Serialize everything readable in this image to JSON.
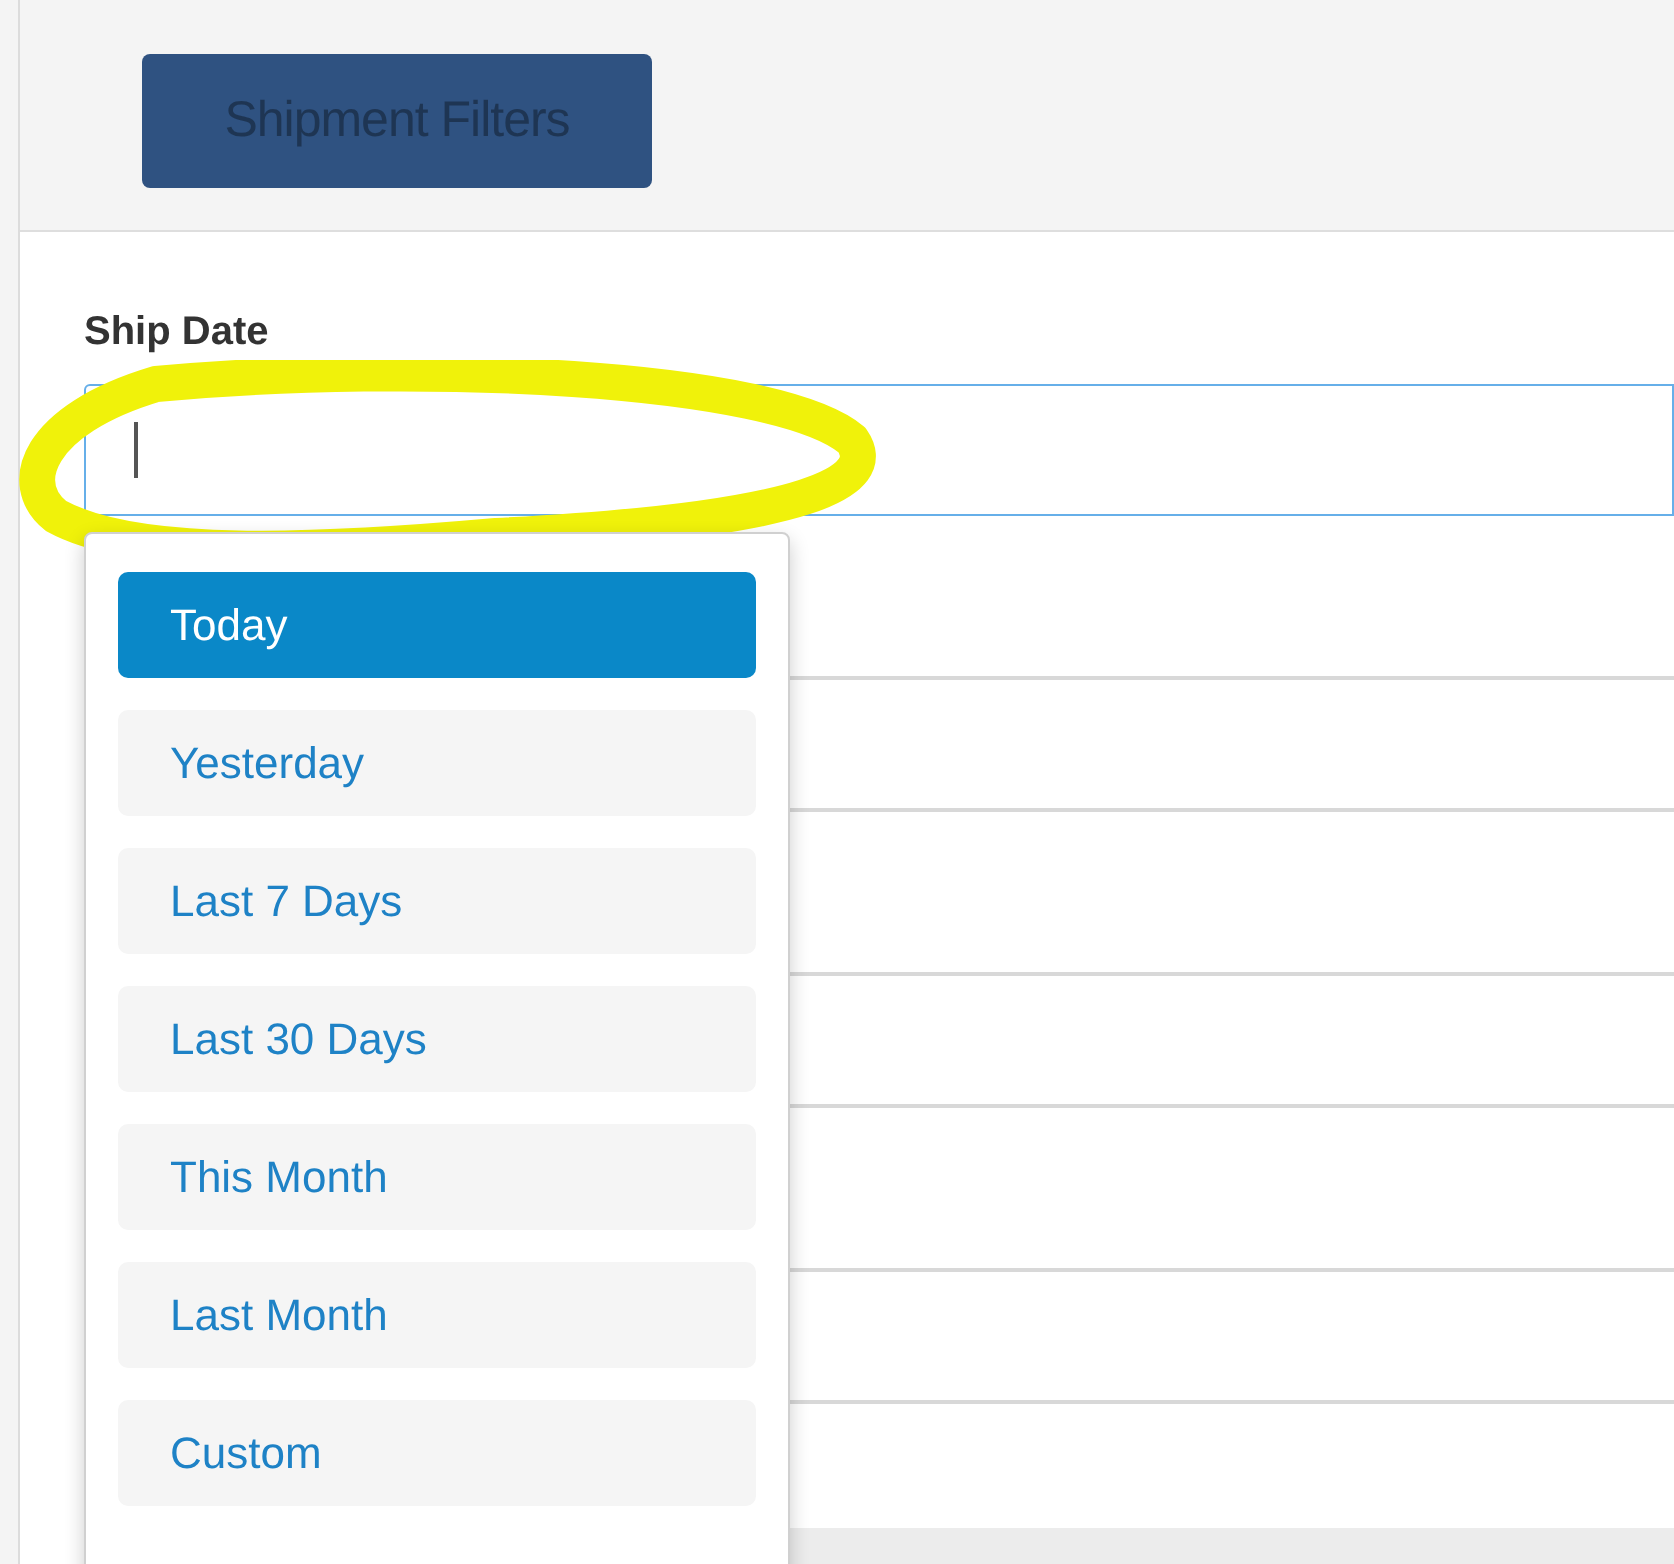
{
  "header": {
    "button": "Shipment Filters"
  },
  "ship_date": {
    "label": "Ship Date",
    "focused": true,
    "options": [
      {
        "label": "Today",
        "selected": true
      },
      {
        "label": "Yesterday",
        "selected": false
      },
      {
        "label": "Last 7 Days",
        "selected": false
      },
      {
        "label": "Last 30 Days",
        "selected": false
      },
      {
        "label": "This Month",
        "selected": false
      },
      {
        "label": "Last Month",
        "selected": false
      },
      {
        "label": "Custom",
        "selected": false
      }
    ]
  }
}
